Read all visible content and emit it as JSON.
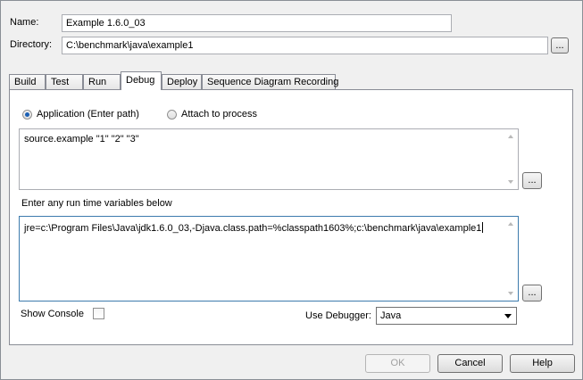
{
  "header": {
    "name_label": "Name:",
    "name_value": "Example 1.6.0_03",
    "directory_label": "Directory:",
    "directory_value": "C:\\benchmark\\java\\example1",
    "browse_label": "..."
  },
  "tabs": [
    {
      "label": "Build",
      "active": false
    },
    {
      "label": "Test",
      "active": false
    },
    {
      "label": "Run",
      "active": false
    },
    {
      "label": "Debug",
      "active": true
    },
    {
      "label": "Deploy",
      "active": false
    },
    {
      "label": "Sequence Diagram Recording",
      "active": false
    }
  ],
  "debug": {
    "radio_application_label": "Application (Enter path)",
    "radio_attach_label": "Attach to process",
    "selected_radio": "application",
    "application_args": "source.example \"1\" \"2\" \"3\"",
    "args_browse_label": "...",
    "runtime_vars_label": "Enter any run time variables below",
    "runtime_vars_value": "jre=c:\\Program Files\\Java\\jdk1.6.0_03,-Djava.class.path=%classpath1603%;c:\\benchmark\\java\\example1",
    "runtime_browse_label": "...",
    "show_console_label": "Show Console",
    "show_console_checked": false,
    "use_debugger_label": "Use Debugger:",
    "debugger_selected": "Java"
  },
  "footer": {
    "ok_label": "OK",
    "cancel_label": "Cancel",
    "help_label": "Help"
  }
}
